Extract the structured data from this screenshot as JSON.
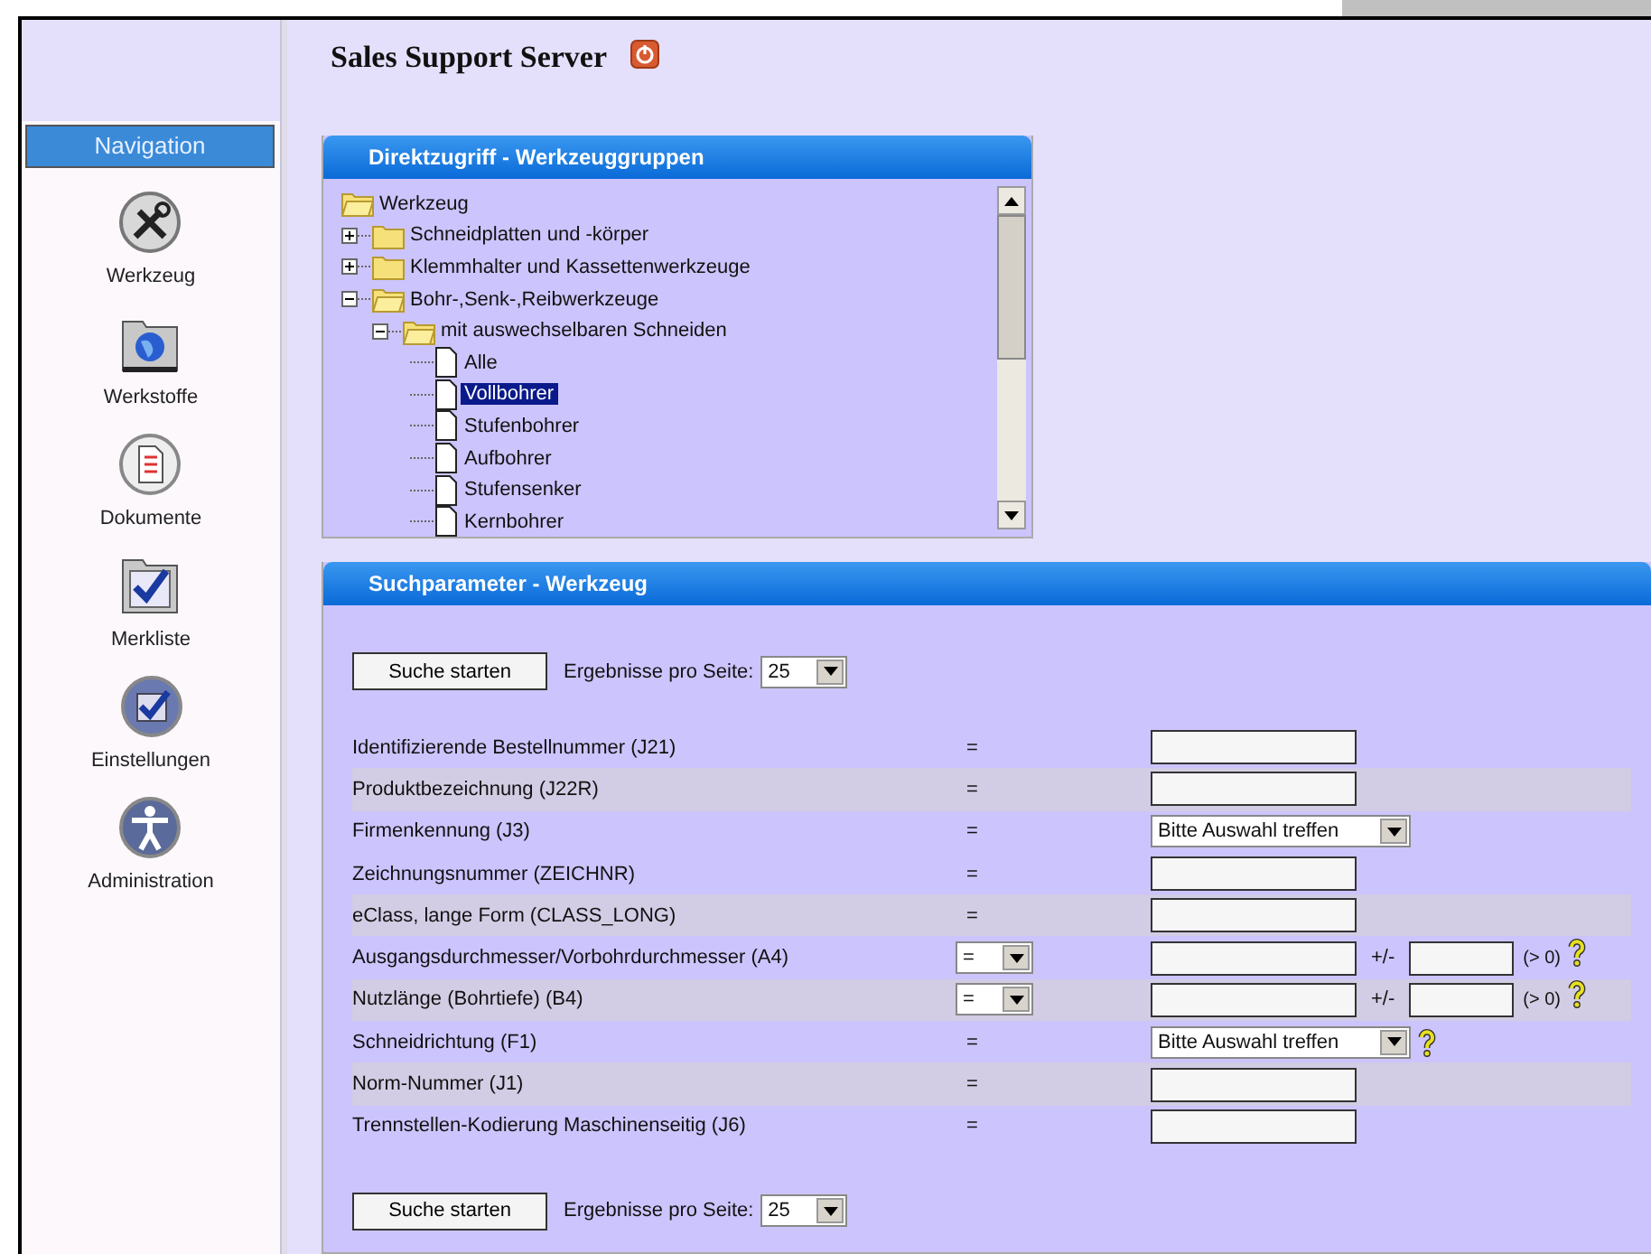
{
  "title": "Sales Support Server",
  "navigation": {
    "heading": "Navigation",
    "items": [
      {
        "label": "Werkzeug"
      },
      {
        "label": "Werkstoffe"
      },
      {
        "label": "Dokumente"
      },
      {
        "label": "Merkliste"
      },
      {
        "label": "Einstellungen"
      },
      {
        "label": "Administration"
      }
    ]
  },
  "tree_panel": {
    "title": "Direktzugriff - Werkzeuggruppen",
    "nodes": [
      {
        "label": "Werkzeug",
        "kind": "root",
        "expanded": true,
        "selected": false,
        "children": [
          {
            "label": "Schneidplatten und -körper",
            "kind": "folder",
            "expanded": false,
            "selected": false
          },
          {
            "label": "Klemmhalter und Kassettenwerkzeuge",
            "kind": "folder",
            "expanded": false,
            "selected": false
          },
          {
            "label": "Bohr-,Senk-,Reibwerkzeuge",
            "kind": "folder",
            "expanded": true,
            "selected": false,
            "children": [
              {
                "label": "mit auswechselbaren Schneiden",
                "kind": "folder",
                "expanded": true,
                "selected": false,
                "children": [
                  {
                    "label": "Alle",
                    "kind": "file",
                    "selected": false
                  },
                  {
                    "label": "Vollbohrer",
                    "kind": "file",
                    "selected": true
                  },
                  {
                    "label": "Stufenbohrer",
                    "kind": "file",
                    "selected": false
                  },
                  {
                    "label": "Aufbohrer",
                    "kind": "file",
                    "selected": false
                  },
                  {
                    "label": "Stufensenker",
                    "kind": "file",
                    "selected": false
                  },
                  {
                    "label": "Kernbohrer",
                    "kind": "file",
                    "selected": false
                  }
                ]
              }
            ]
          }
        ]
      }
    ]
  },
  "search_panel": {
    "title": "Suchparameter - Werkzeug",
    "top_bar": {
      "button": "Suche starten",
      "page_size_label": "Ergebnisse pro Seite:",
      "page_size": "25"
    },
    "rows": [
      {
        "label": "Identifizierende Bestellnummer (J21)",
        "kind": "text",
        "operator": "=",
        "shaded": false
      },
      {
        "label": "Produktbezeichnung (J22R)",
        "kind": "text",
        "operator": "=",
        "shaded": true
      },
      {
        "label": "Firmenkennung (J3)",
        "kind": "select",
        "operator": "=",
        "value": "Bitte Auswahl treffen",
        "help": false,
        "shaded": false
      },
      {
        "label": "Zeichnungsnummer (ZEICHNR)",
        "kind": "text",
        "operator": "=",
        "shaded": false
      },
      {
        "label": "eClass, lange Form (CLASS_LONG)",
        "kind": "text",
        "operator": "=",
        "shaded": true
      },
      {
        "label": "Ausgangsdurchmesser/Vorbohrdurchmesser (A4)",
        "kind": "range",
        "operator": "=",
        "tolerance_label": "+/-",
        "hint": "(> 0)",
        "help": true,
        "shaded": false
      },
      {
        "label": "Nutzlänge (Bohrtiefe) (B4)",
        "kind": "range",
        "operator": "=",
        "tolerance_label": "+/-",
        "hint": "(> 0)",
        "help": true,
        "shaded": true
      },
      {
        "label": "Schneidrichtung (F1)",
        "kind": "select",
        "operator": "=",
        "value": "Bitte Auswahl treffen",
        "help": true,
        "shaded": false
      },
      {
        "label": "Norm-Nummer (J1)",
        "kind": "text",
        "operator": "=",
        "shaded": true
      },
      {
        "label": "Trennstellen-Kodierung Maschinenseitig (J6)",
        "kind": "text",
        "operator": "=",
        "shaded": false
      }
    ],
    "bottom_bar": {
      "button": "Suche starten",
      "page_size_label": "Ergebnisse pro Seite:",
      "page_size": "25"
    }
  }
}
